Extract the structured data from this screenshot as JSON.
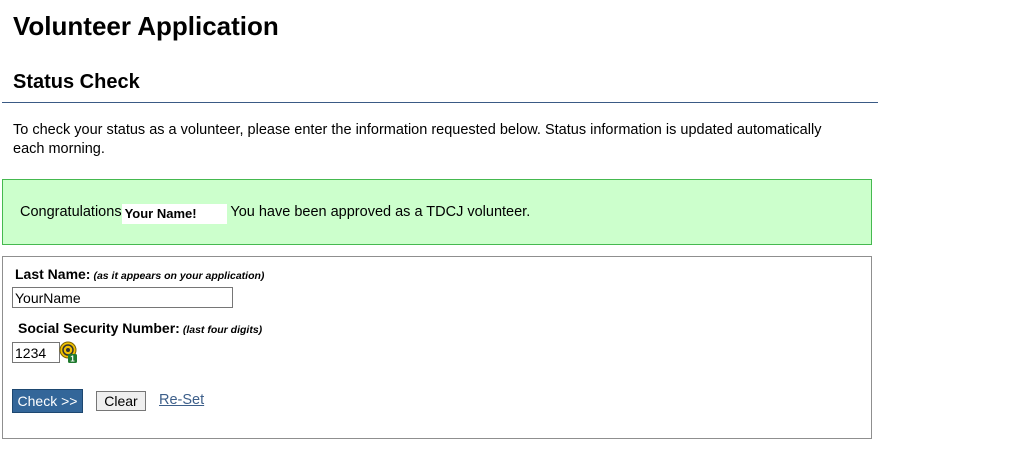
{
  "header": {
    "title": "Volunteer Application",
    "section_title": "Status Check"
  },
  "intro": {
    "text": "To check your status as a volunteer, please enter the information requested below. Status information is updated automatically each morning."
  },
  "alert": {
    "prefix": "Congratulations",
    "name": "Your Name!",
    "suffix": "You have been approved as a TDCJ volunteer.",
    "bg_color": "#ccffcc",
    "border_color": "#45b94f"
  },
  "form": {
    "last_name": {
      "label": "Last Name:",
      "hint": "(as it appears on your application)",
      "value": "YourName"
    },
    "ssn": {
      "label": "Social Security Number:",
      "hint": "(last four digits)",
      "value": "1234",
      "icon": "password-manager-icon",
      "icon_badge": "1"
    },
    "check_button": "Check >>",
    "clear_button": "Clear",
    "reset_link": "Re-Set"
  },
  "colors": {
    "primary_button": "#336699",
    "link": "#3d5f8a",
    "divider": "#3a5a85"
  }
}
